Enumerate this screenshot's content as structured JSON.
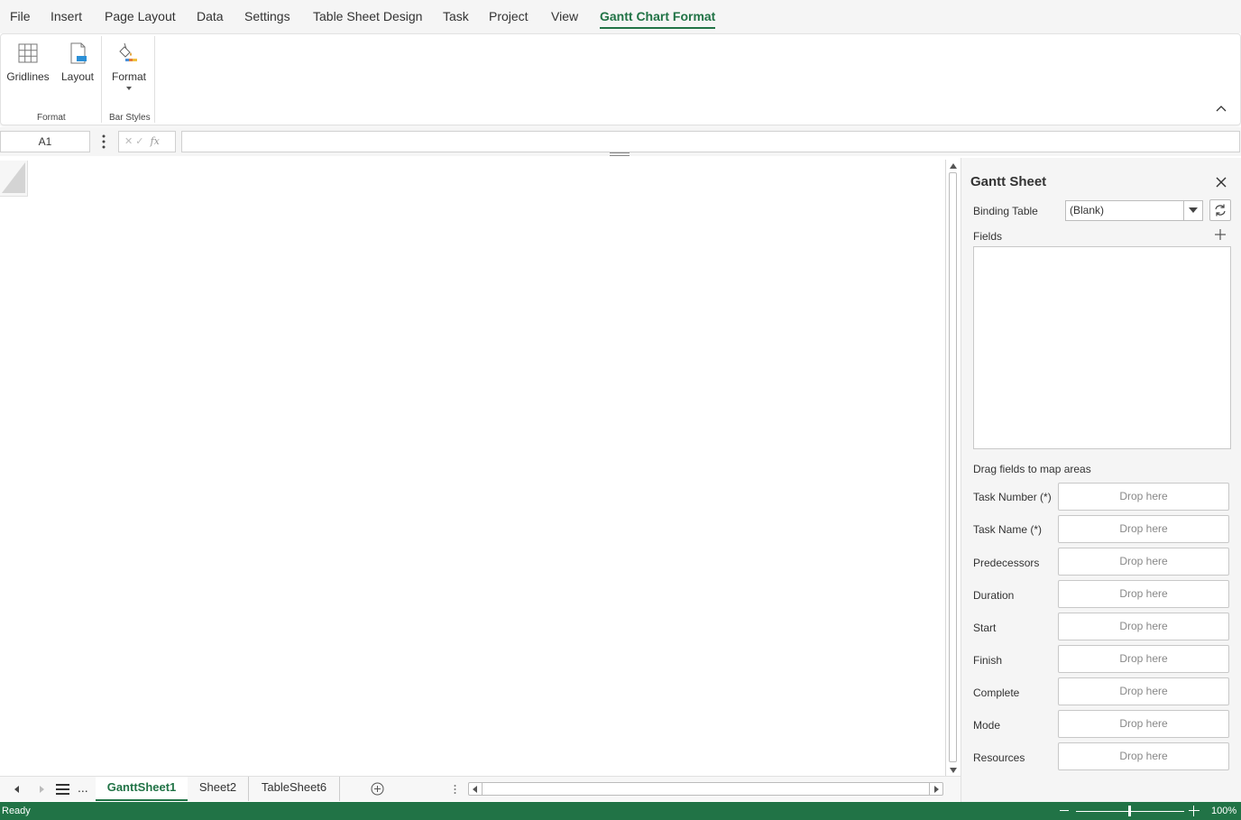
{
  "menu": {
    "items": [
      "File",
      "Insert",
      "Page Layout",
      "Data",
      "Settings",
      "Table Sheet Design",
      "Task",
      "Project",
      "View",
      "Gantt Chart Format"
    ],
    "active": "Gantt Chart Format"
  },
  "ribbon": {
    "gridlines_label": "Gridlines",
    "layout_label": "Layout",
    "format_label": "Format",
    "group_format": "Format",
    "group_bar_styles": "Bar Styles"
  },
  "formula_bar": {
    "name_box": "A1",
    "formula": ""
  },
  "tabs": {
    "sheets": [
      "GanttSheet1",
      "Sheet2",
      "TableSheet6"
    ],
    "active": "GanttSheet1",
    "more": "..."
  },
  "status": {
    "text": "Ready",
    "zoom": "100%"
  },
  "panel": {
    "title": "Gantt Sheet",
    "binding_table_label": "Binding Table",
    "binding_table_value": "(Blank)",
    "fields_label": "Fields",
    "drag_hint": "Drag fields to map areas",
    "drop_placeholder": "Drop here",
    "mappings": [
      {
        "label": "Task Number (*)"
      },
      {
        "label": "Task Name (*)"
      },
      {
        "label": "Predecessors"
      },
      {
        "label": "Duration"
      },
      {
        "label": "Start"
      },
      {
        "label": "Finish"
      },
      {
        "label": "Complete"
      },
      {
        "label": "Mode"
      },
      {
        "label": "Resources"
      }
    ]
  },
  "colors": {
    "accent": "#217346"
  }
}
